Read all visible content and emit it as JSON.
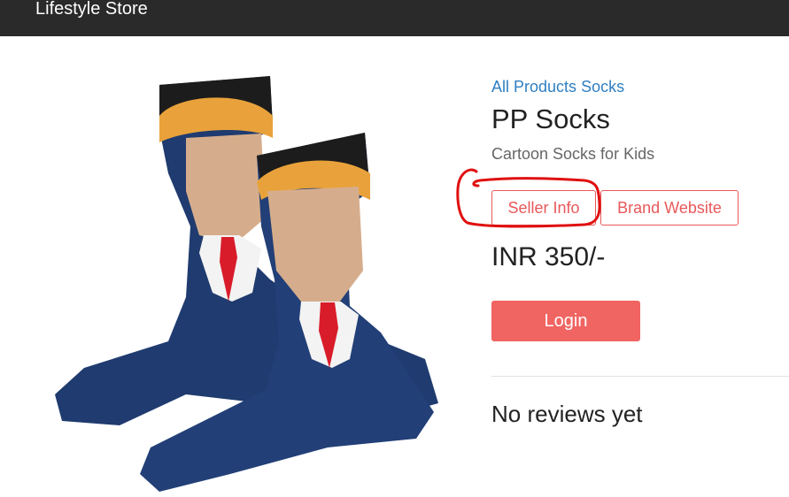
{
  "navbar": {
    "brand": "Lifestyle Store"
  },
  "product": {
    "breadcrumb": [
      "All Products",
      "Socks"
    ],
    "title": "PP Socks",
    "subtitle": "Cartoon Socks for Kids",
    "buttons": {
      "seller_info": "Seller Info",
      "brand_website": "Brand Website"
    },
    "price": "INR 350/-",
    "login_label": "Login",
    "reviews_heading": "No reviews yet"
  },
  "colors": {
    "navbar_bg": "#2a2a2a",
    "accent": "#e8585a",
    "login_bg": "#f06461",
    "link": "#2f7fc1",
    "annotation": "#e01010"
  },
  "icons": [
    "product-image",
    "annotation-circle"
  ]
}
